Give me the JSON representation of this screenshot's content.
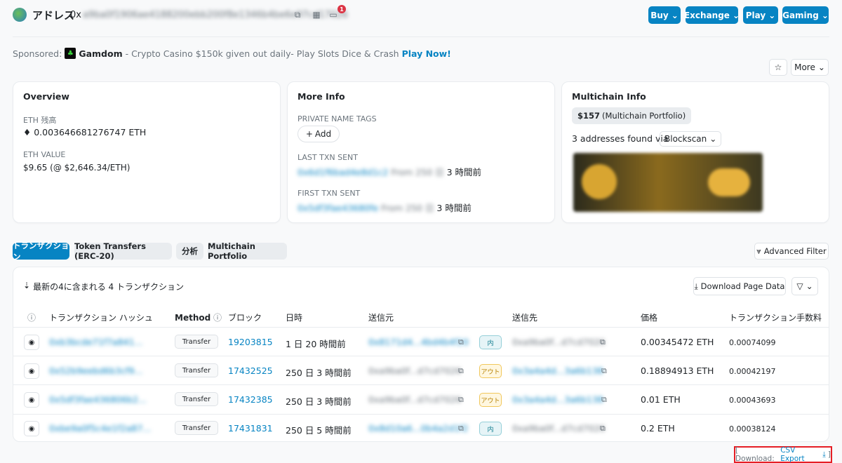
{
  "header": {
    "title": "アドレス",
    "address": "0x",
    "notification_count": "1",
    "buttons": [
      "Buy",
      "Exchange",
      "Play",
      "Gaming"
    ]
  },
  "sponsored": {
    "label": "Sponsored:",
    "brand": "Gamdom",
    "text": "- Crypto Casino $150k given out daily- Play Slots Dice & Crash",
    "cta": "Play Now!"
  },
  "actions": {
    "more_label": "More"
  },
  "overview": {
    "title": "Overview",
    "eth_balance_label": "ETH 残高",
    "eth_balance": "0.003646681276747 ETH",
    "eth_value_label": "ETH VALUE",
    "eth_value": "$9.65 (@ $2,646.34/ETH)"
  },
  "more_info": {
    "title": "More Info",
    "private_tags_label": "PRIVATE NAME TAGS",
    "add_label": "Add",
    "last_txn_label": "LAST TXN SENT",
    "last_txn_time": "3 時間前",
    "first_txn_label": "FIRST TXN SENT",
    "first_txn_time": "3 時間前"
  },
  "multichain": {
    "title": "Multichain Info",
    "portfolio_value": "$157",
    "portfolio_label": "(Multichain Portfolio)",
    "found_text": "3 addresses found via",
    "blockscan": "Blockscan"
  },
  "tabs": [
    "トランザクション",
    "Token Transfers (ERC-20)",
    "分析",
    "Multichain Portfolio"
  ],
  "advanced_filter": "Advanced Filter",
  "table": {
    "summary": "最新の4に含まれる 4 トランザクション",
    "download_label": "Download Page Data",
    "headers": {
      "hash": "トランザクション ハッシュ",
      "method": "Method",
      "block": "ブロック",
      "age": "日時",
      "from": "送信元",
      "to": "送信先",
      "value": "価格",
      "fee": "トランザクション手数料"
    },
    "rows": [
      {
        "method": "Transfer",
        "block": "19203815",
        "age": "1 日 20 時間前",
        "dir": "内",
        "value": "0.00345472 ETH",
        "fee": "0.00074099"
      },
      {
        "method": "Transfer",
        "block": "17432525",
        "age": "250 日 3 時間前",
        "dir": "アウト",
        "value": "0.18894913 ETH",
        "fee": "0.00042197"
      },
      {
        "method": "Transfer",
        "block": "17432385",
        "age": "250 日 3 時間前",
        "dir": "アウト",
        "value": "0.01 ETH",
        "fee": "0.00043693"
      },
      {
        "method": "Transfer",
        "block": "17431831",
        "age": "250 日 5 時間前",
        "dir": "内",
        "value": "0.2 ETH",
        "fee": "0.00038124"
      }
    ]
  },
  "csv": {
    "prefix": "[ Download:",
    "link": "CSV Export",
    "suffix": "]"
  }
}
